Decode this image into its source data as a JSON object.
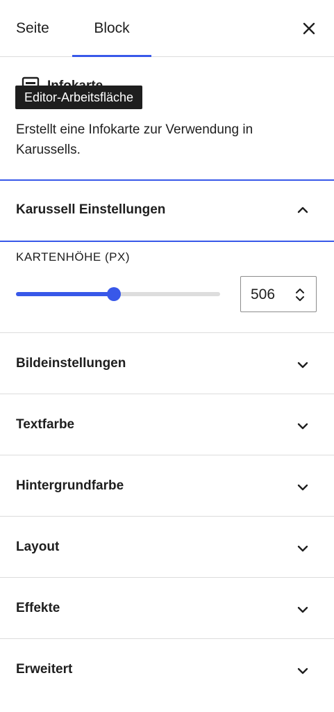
{
  "tabs": {
    "page_label": "Seite",
    "block_label": "Block",
    "active": "Block"
  },
  "colors": {
    "accent": "#3858e9",
    "text": "#1e1e1e",
    "border": "#dcdcdc",
    "tooltip_bg": "#1e1e1e"
  },
  "block": {
    "name": "Infokarte",
    "description": "Erstellt eine Infokarte zur Verwendung in Karussells.",
    "tooltip": "Editor-Arbeitsfläche",
    "icon": "block-card-icon"
  },
  "panel_open": {
    "title": "Karussell Einstellungen",
    "field_label": "KARTENHÖHE (PX)",
    "value": "506",
    "slider_fraction": 0.48
  },
  "panels": [
    {
      "title": "Bildeinstellungen"
    },
    {
      "title": "Textfarbe"
    },
    {
      "title": "Hintergrundfarbe"
    },
    {
      "title": "Layout"
    },
    {
      "title": "Effekte"
    },
    {
      "title": "Erweitert"
    }
  ]
}
